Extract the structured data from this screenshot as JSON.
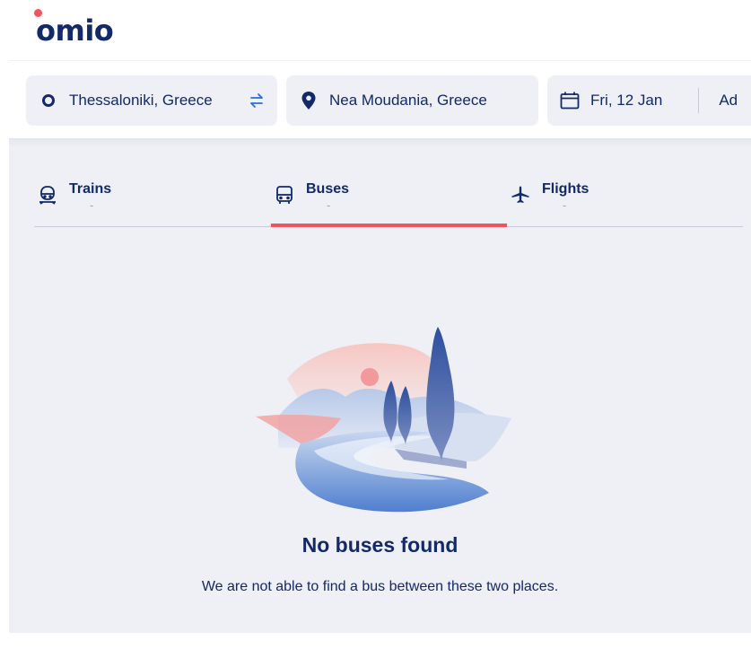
{
  "brand": {
    "name": "omio",
    "accent": "#f2545b",
    "primary": "#132968"
  },
  "search": {
    "origin": "Thessaloniki, Greece",
    "destination": "Nea Moudania, Greece",
    "date": "Fri, 12 Jan",
    "passengers_partial": "Ad"
  },
  "icons": {
    "origin": "origin-circle-icon",
    "swap": "swap-arrows-icon",
    "destination": "location-pin-icon",
    "date": "calendar-icon",
    "trains": "train-icon",
    "buses": "bus-icon",
    "flights": "airplane-icon"
  },
  "tabs": [
    {
      "label": "Trains",
      "sub": "-",
      "active": false
    },
    {
      "label": "Buses",
      "sub": "-",
      "active": true
    },
    {
      "label": "Flights",
      "sub": "-",
      "active": false
    }
  ],
  "empty_state": {
    "title": "No buses found",
    "message": "We are not able to find a bus between these two places."
  }
}
